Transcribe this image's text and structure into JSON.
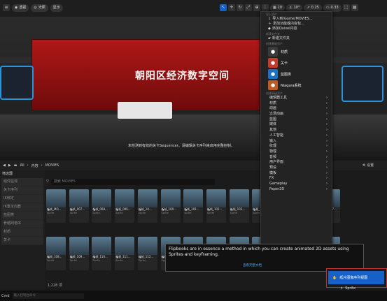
{
  "viewport": {
    "toolbar": {
      "perspective": "透视",
      "lit": "光照",
      "show": "显示",
      "grid_snap": "10",
      "rotate_snap": "10°",
      "scale_snap": "0.25",
      "camera_speed": "0.33"
    },
    "banner_text": "朝阳区经济数字空间",
    "sequencer_msg": "未检测到有效的关卡Sequencer。请编辑关卡序列来启用完整控制。"
  },
  "context_menu": {
    "section_import": "导入资产",
    "import_items": [
      "导入到/Game/MOVIES...",
      "添加功能或内容包...",
      "添加Quixel内容"
    ],
    "section_folder": "新建文件夹",
    "new_folder": "新建文件夹",
    "section_basic": "创建基础资产",
    "basic_assets": [
      {
        "label": "材质",
        "icon": "material-icon",
        "color": "#3a3a3a"
      },
      {
        "label": "关卡",
        "icon": "level-icon",
        "color": "#c43b2b"
      },
      {
        "label": "蓝图类",
        "icon": "blueprint-icon",
        "color": "#1e6fc7"
      },
      {
        "label": "Niagara系统",
        "icon": "niagara-icon",
        "color": "#c05a24"
      }
    ],
    "section_advanced": "创建高级资产",
    "advanced_assets": [
      "编辑器工具",
      "材质",
      "动画",
      "过场动画",
      "蓝图",
      "媒体",
      "其他",
      "人工智能",
      "输入",
      "纹理",
      "物理",
      "音频",
      "用户界面",
      "预设",
      "模板",
      "FX",
      "Gameplay",
      "Paper2D"
    ]
  },
  "browser": {
    "add_button": "添加",
    "breadcrumb": [
      "All",
      "内容",
      "MOVIES"
    ],
    "settings": "设置",
    "sidebar_title": "筛选器",
    "filters": [
      "组件监测",
      "关卡序列",
      "IK绑定",
      "IK重定向器",
      "蓝图类",
      "骨骼网格体",
      "材质",
      "关卡"
    ],
    "search_placeholder": "搜索 MOVIES",
    "assets": [
      {
        "name": "新帧_MO...",
        "type": "Sprite"
      },
      {
        "name": "新帧_007...",
        "type": "Sprite"
      },
      {
        "name": "新帧_008...",
        "type": "Sprite"
      },
      {
        "name": "新帧_009...",
        "type": "Sprite"
      },
      {
        "name": "新帧_10...",
        "type": "Sprite"
      },
      {
        "name": "新帧_100...",
        "type": "Sprite"
      },
      {
        "name": "新帧_101...",
        "type": "Sprite"
      },
      {
        "name": "新帧_102...",
        "type": "Sprite"
      },
      {
        "name": "新帧_103...",
        "type": "Sprite"
      },
      {
        "name": "新帧_104...",
        "type": "Sprite"
      },
      {
        "name": "新帧_105...",
        "type": "Sprite"
      },
      {
        "name": "新帧_106...",
        "type": "Sprite"
      },
      {
        "name": "新帧_107...",
        "type": "Sprite"
      },
      {
        "name": "新帧_108...",
        "type": "Sprite"
      },
      {
        "name": "新帧_109...",
        "type": "Sprite"
      },
      {
        "name": "新帧_110...",
        "type": "Sprite"
      },
      {
        "name": "新帧_111...",
        "type": "Sprite"
      },
      {
        "name": "新帧_112...",
        "type": "Sprite"
      },
      {
        "name": "新帧_113...",
        "type": "Sprite"
      },
      {
        "name": "新帧_114...",
        "type": "Sprite"
      },
      {
        "name": "新帧_115...",
        "type": "Sprite"
      },
      {
        "name": "新帧_116...",
        "type": "Sprite"
      },
      {
        "name": "新帧_117...",
        "type": "Sprite"
      },
      {
        "name": "新帧_118...",
        "type": "Sprite"
      },
      {
        "name": "新帧_119...",
        "type": "Sprite"
      },
      {
        "name": "新帧_120...",
        "type": "Sprite"
      }
    ],
    "item_count": "1,228 项",
    "cmd_label": "Cmd",
    "cmd_placeholder": "输入控制台命令"
  },
  "tooltip": {
    "text": "Flipbooks are in essence a method in which you can create animated 2D assets using Sprites and keyframing.",
    "link": "查看完整文档"
  },
  "flipbook_button": "纸片图像序列视图",
  "sprite_label": "Sprite",
  "colors": {
    "accent": "#1561c7",
    "highlight": "#c83030"
  }
}
